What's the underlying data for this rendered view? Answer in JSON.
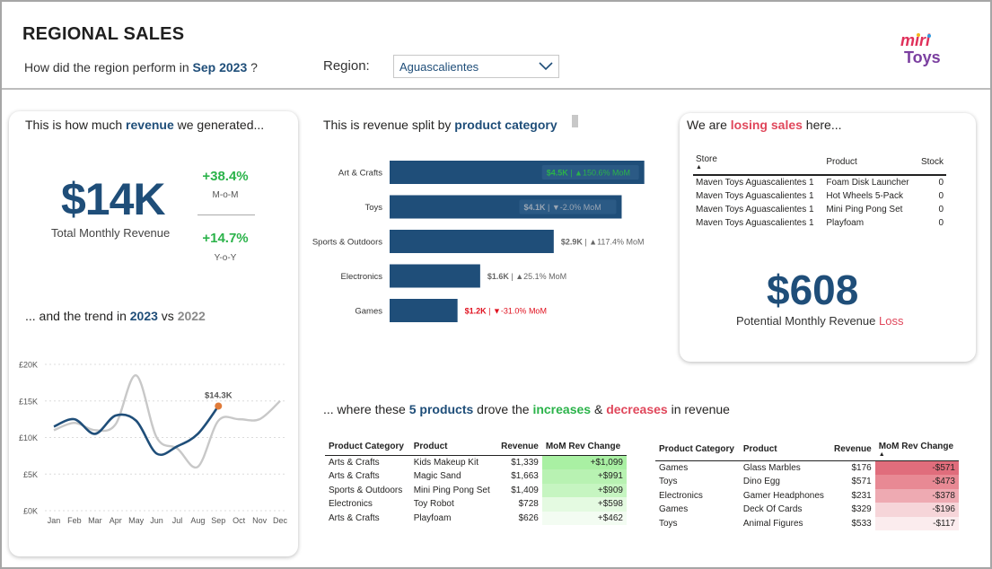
{
  "header": {
    "title": "REGIONAL SALES",
    "subtitle_prefix": "How did the region perform in ",
    "subtitle_period": "Sep 2023",
    "subtitle_suffix": " ?",
    "region_label": "Region:",
    "region_value": "Aguascalientes",
    "logo_text_top": "miri",
    "logo_text_bottom": "Toys"
  },
  "revenue_section": {
    "title_prefix": "This is how much ",
    "title_bold": "revenue",
    "title_suffix": " we generated...",
    "kpi_value": "$14K",
    "kpi_label": "Total Monthly Revenue",
    "mom_value": "+38.4%",
    "mom_label": "M-o-M",
    "yoy_value": "+14.7%",
    "yoy_label": "Y-o-Y"
  },
  "trend_section": {
    "title_prefix": "... and the trend in ",
    "title_year_current": "2023",
    "title_vs": " vs ",
    "title_year_prior": "2022"
  },
  "category_section": {
    "title_prefix": "This is revenue split by ",
    "title_bold": "product category"
  },
  "loss_section": {
    "title_prefix": "We are ",
    "title_bold": "losing sales",
    "title_suffix": " here...",
    "columns": [
      "Store",
      "Product",
      "Stock"
    ],
    "rows": [
      {
        "store": "Maven Toys Aguascalientes 1",
        "product": "Foam Disk Launcher",
        "stock": "0"
      },
      {
        "store": "Maven Toys Aguascalientes 1",
        "product": "Hot Wheels 5-Pack",
        "stock": "0"
      },
      {
        "store": "Maven Toys Aguascalientes 1",
        "product": "Mini Ping Pong Set",
        "stock": "0"
      },
      {
        "store": "Maven Toys Aguascalientes 1",
        "product": "Playfoam",
        "stock": "0"
      }
    ],
    "loss_value": "$608",
    "loss_label_prefix": "Potential Monthly Revenue ",
    "loss_label_red": "Loss"
  },
  "products_section": {
    "title_prefix": "... where these ",
    "title_count": "5 products",
    "title_mid": " drove the ",
    "title_increases": "increases",
    "title_amp": " & ",
    "title_decreases": "decreases",
    "title_suffix": " in revenue",
    "columns": [
      "Product Category",
      "Product",
      "Revenue",
      "MoM Rev Change"
    ],
    "increases": [
      {
        "category": "Arts & Crafts",
        "product": "Kids Makeup Kit",
        "revenue": "$1,339",
        "change": "+$1,099",
        "color": "#a9f0a3"
      },
      {
        "category": "Arts & Crafts",
        "product": "Magic Sand",
        "revenue": "$1,663",
        "change": "+$991",
        "color": "#b8f2b2"
      },
      {
        "category": "Sports & Outdoors",
        "product": "Mini Ping Pong Set",
        "revenue": "$1,409",
        "change": "+$909",
        "color": "#c6f5c1"
      },
      {
        "category": "Electronics",
        "product": "Toy Robot",
        "revenue": "$728",
        "change": "+$598",
        "color": "#e4fae1"
      },
      {
        "category": "Arts & Crafts",
        "product": "Playfoam",
        "revenue": "$626",
        "change": "+$462",
        "color": "#f3fcf2"
      }
    ],
    "decreases": [
      {
        "category": "Games",
        "product": "Glass Marbles",
        "revenue": "$176",
        "change": "-$571",
        "color": "#e06d7c"
      },
      {
        "category": "Toys",
        "product": "Dino Egg",
        "revenue": "$571",
        "change": "-$473",
        "color": "#e88994"
      },
      {
        "category": "Electronics",
        "product": "Gamer Headphones",
        "revenue": "$231",
        "change": "-$378",
        "color": "#eeaab2"
      },
      {
        "category": "Games",
        "product": "Deck Of Cards",
        "revenue": "$329",
        "change": "-$196",
        "color": "#f6d5d9"
      },
      {
        "category": "Toys",
        "product": "Animal Figures",
        "revenue": "$533",
        "change": "-$117",
        "color": "#fbecee"
      }
    ]
  },
  "chart_data": [
    {
      "type": "bar",
      "orientation": "horizontal",
      "categories": [
        "Art & Crafts",
        "Toys",
        "Sports & Outdoors",
        "Electronics",
        "Games"
      ],
      "values": [
        4.5,
        4.1,
        2.9,
        1.6,
        1.2
      ],
      "value_labels": [
        "$4.5K",
        "$4.1K",
        "$2.9K",
        "$1.6K",
        "$1.2K"
      ],
      "mom_labels": [
        "150.6% MoM",
        "-2.0% MoM",
        "117.4% MoM",
        "25.1% MoM",
        "-31.0% MoM"
      ],
      "mom_direction": [
        "up",
        "down",
        "up",
        "up",
        "down"
      ],
      "label_colors": [
        "#2bb34a",
        "#9aa6b4",
        "#666666",
        "#666666",
        "#e0101e"
      ],
      "bar_color": "#1f4e79",
      "xlim": [
        0,
        4.6
      ]
    },
    {
      "type": "line",
      "x": [
        "Jan",
        "Feb",
        "Mar",
        "Apr",
        "May",
        "Jun",
        "Jul",
        "Aug",
        "Sep",
        "Oct",
        "Nov",
        "Dec"
      ],
      "series": [
        {
          "name": "2023",
          "values": [
            11.5,
            12.5,
            10.5,
            13.0,
            12.3,
            7.8,
            8.8,
            10.5,
            14.3,
            null,
            null,
            null
          ],
          "color": "#1f4e79"
        },
        {
          "name": "2022",
          "values": [
            11.0,
            12.0,
            11.0,
            11.8,
            18.5,
            10.0,
            8.5,
            6.0,
            12.3,
            12.5,
            12.5,
            15.0
          ],
          "color": "#c8c8c8"
        }
      ],
      "annotation": "$14.3K",
      "annotation_color": "#e07b39",
      "y_ticks": [
        "£0K",
        "£5K",
        "£10K",
        "£15K",
        "£20K"
      ],
      "ylim": [
        0,
        20
      ],
      "grid": true
    }
  ]
}
